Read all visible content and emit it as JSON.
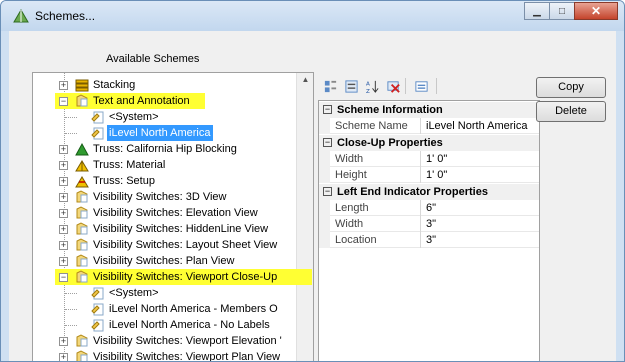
{
  "window": {
    "title": "Schemes...",
    "minimize_glyph": "▁",
    "maximize_glyph": "□",
    "close_glyph": "✕"
  },
  "available_label": "Available Schemes",
  "tree": [
    {
      "label": "Stacking",
      "level": 0,
      "expander": "+",
      "icon": "stacking-icon",
      "style": ""
    },
    {
      "label": "Text and Annotation",
      "level": 0,
      "expander": "−",
      "icon": "folder-scheme-icon",
      "style": "highlight"
    },
    {
      "label": "<System>",
      "level": 1,
      "expander": "",
      "icon": "scheme-file-icon",
      "style": ""
    },
    {
      "label": "iLevel North America",
      "level": 1,
      "expander": "",
      "icon": "scheme-file-icon",
      "style": "selected"
    },
    {
      "label": "Truss: California Hip Blocking",
      "level": 0,
      "expander": "+",
      "icon": "truss-green-icon",
      "style": ""
    },
    {
      "label": "Truss: Material",
      "level": 0,
      "expander": "+",
      "icon": "truss-material-icon",
      "style": ""
    },
    {
      "label": "Truss: Setup",
      "level": 0,
      "expander": "+",
      "icon": "truss-setup-icon",
      "style": ""
    },
    {
      "label": "Visibility Switches: 3D View",
      "level": 0,
      "expander": "+",
      "icon": "folder-scheme-icon",
      "style": ""
    },
    {
      "label": "Visibility Switches: Elevation View",
      "level": 0,
      "expander": "+",
      "icon": "folder-scheme-icon",
      "style": ""
    },
    {
      "label": "Visibility Switches: HiddenLine View",
      "level": 0,
      "expander": "+",
      "icon": "folder-scheme-icon",
      "style": ""
    },
    {
      "label": "Visibility Switches: Layout Sheet View",
      "level": 0,
      "expander": "+",
      "icon": "folder-scheme-icon",
      "style": ""
    },
    {
      "label": "Visibility Switches: Plan View",
      "level": 0,
      "expander": "+",
      "icon": "folder-scheme-icon",
      "style": ""
    },
    {
      "label": "Visibility Switches: Viewport Close-Up",
      "level": 0,
      "expander": "−",
      "icon": "folder-scheme-icon",
      "style": "highlight"
    },
    {
      "label": "<System>",
      "level": 1,
      "expander": "",
      "icon": "scheme-file-icon",
      "style": ""
    },
    {
      "label": "iLevel North America - Members O",
      "level": 1,
      "expander": "",
      "icon": "scheme-file-icon",
      "style": ""
    },
    {
      "label": "iLevel North America - No Labels",
      "level": 1,
      "expander": "",
      "icon": "scheme-file-icon",
      "style": ""
    },
    {
      "label": "Visibility Switches: Viewport Elevation '",
      "level": 0,
      "expander": "+",
      "icon": "folder-scheme-icon",
      "style": ""
    },
    {
      "label": "Visibility Switches: Viewport Plan View",
      "level": 0,
      "expander": "+",
      "icon": "folder-scheme-icon",
      "style": ""
    }
  ],
  "toolbar": {
    "buttons": [
      "categorized-icon",
      "alphabetical-icon",
      "sort-az-icon",
      "delete-property-icon",
      "property-pages-icon"
    ]
  },
  "properties": [
    {
      "kind": "category",
      "label": "Scheme Information",
      "toggle": "−"
    },
    {
      "kind": "prop",
      "name": "Scheme Name",
      "value": "iLevel North America"
    },
    {
      "kind": "category",
      "label": "Close-Up Properties",
      "toggle": "−"
    },
    {
      "kind": "prop",
      "name": "Width",
      "value": "1' 0\""
    },
    {
      "kind": "prop",
      "name": "Height",
      "value": "1' 0\""
    },
    {
      "kind": "category",
      "label": "Left End Indicator Properties",
      "toggle": "−"
    },
    {
      "kind": "prop",
      "name": "Length",
      "value": "6\""
    },
    {
      "kind": "prop",
      "name": "Width",
      "value": "3\""
    },
    {
      "kind": "prop",
      "name": "Location",
      "value": "3\""
    }
  ],
  "buttons": {
    "copy": "Copy",
    "delete": "Delete"
  },
  "colors": {
    "highlight": "#ffff33",
    "selected": "#3399ff"
  }
}
